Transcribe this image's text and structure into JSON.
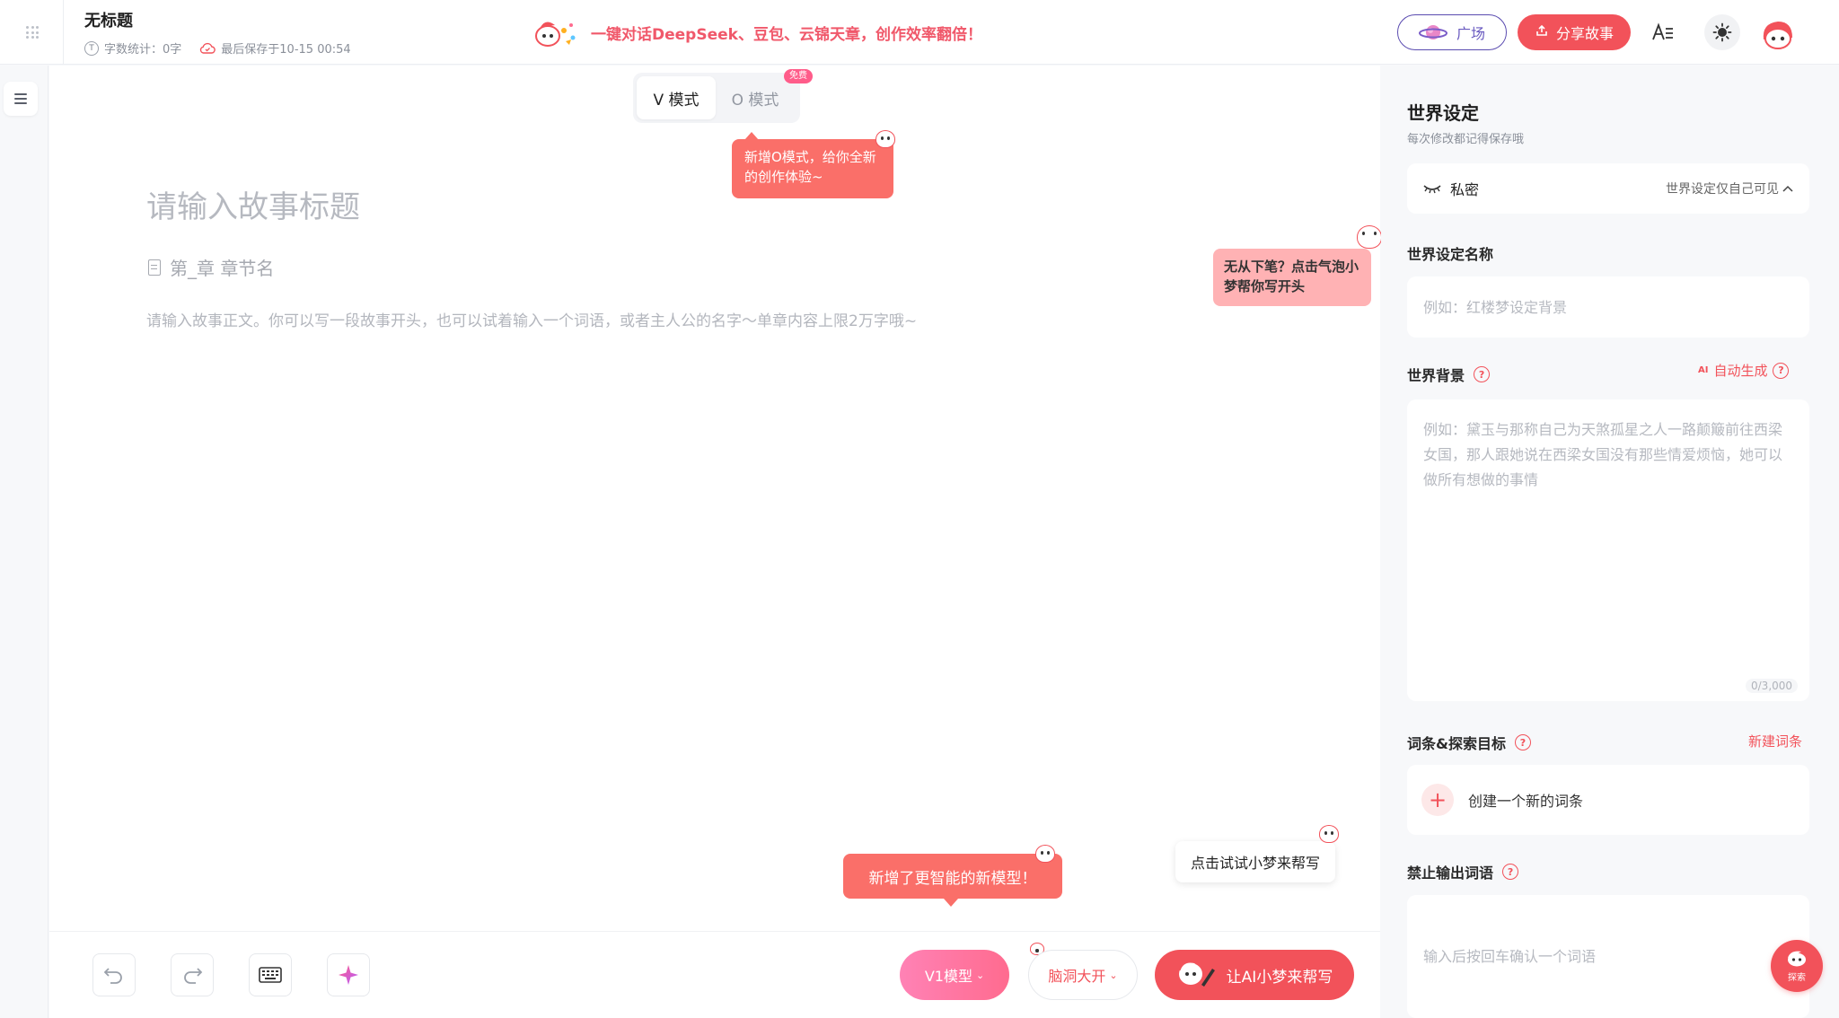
{
  "header": {
    "doc_title": "无标题",
    "word_count": "字数统计：0字",
    "last_saved": "最后保存于10-15 00:54",
    "promo_text": "一键对话DeepSeek、豆包、云锦天章，创作效率翻倍！",
    "plaza_label": "广场",
    "share_label": "分享故事",
    "font_icon": "A☰"
  },
  "editor": {
    "mode_v": "V 模式",
    "mode_o": "O 模式",
    "free_tag": "免费",
    "tip_new_mode": "新增O模式，给你全新的创作体验~",
    "title_placeholder": "请输入故事标题",
    "chapter_placeholder": "第_章 章节名",
    "body_placeholder": "请输入故事正文。你可以写一段故事开头，也可以试着输入一个词语，或者主人公的名字～单章内容上限2万字哦~",
    "tip_bubble": "无从下笔？点击气泡小梦帮你写开头",
    "tip_new_model": "新增了更智能的新模型！",
    "tip_try": "点击试试小梦来帮写",
    "model_btn": "V1模型",
    "brain_btn": "脑洞大开",
    "ai_write_btn": "让AI小梦来帮写"
  },
  "panel": {
    "title": "世界设定",
    "subtitle": "每次修改都记得保存哦",
    "privacy_label": "私密",
    "privacy_value": "世界设定仅自己可见",
    "name_label": "世界设定名称",
    "name_placeholder": "例如：红楼梦设定背景",
    "background_label": "世界背景",
    "auto_gen_badge": "AI",
    "auto_gen": "自动生成",
    "background_placeholder": "例如：黛玉与那称自己为天煞孤星之人一路颠簸前往西梁女国，那人跟她说在西梁女国没有那些情爱烦恼，她可以做所有想做的事情",
    "char_count": "0/3,000",
    "terms_label": "词条&探索目标",
    "new_term": "新建词条",
    "create_term": "创建一个新的词条",
    "banned_label": "禁止输出词语",
    "banned_placeholder": "输入后按回车确认一个词语",
    "search_fab": "探索"
  },
  "colors": {
    "accent": "#f2525a",
    "tip_red": "#fa6f69",
    "tip_pink": "#ffb2b4",
    "plaza_purple": "#5a4bb0"
  }
}
